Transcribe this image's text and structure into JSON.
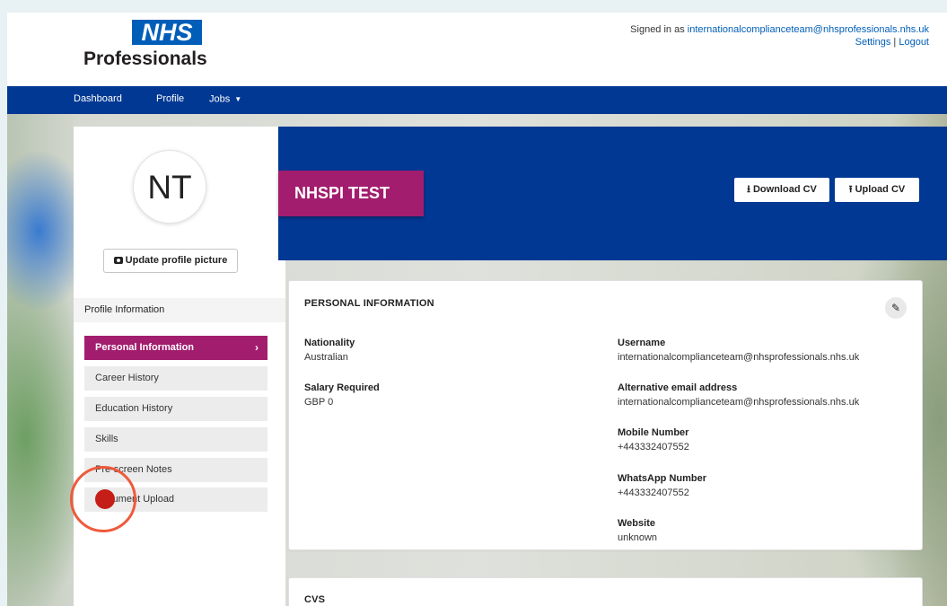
{
  "header": {
    "logo_mark": "NHS",
    "logo_word": "Professionals",
    "signed_in_prefix": "Signed in as",
    "signed_in_email": "internationalcomplianceteam@nhsprofessionals.nhs.uk",
    "settings_link": "Settings",
    "separator": "|",
    "logout_link": "Logout"
  },
  "nav": {
    "items": [
      "Dashboard",
      "Profile",
      "Jobs"
    ]
  },
  "sidebar": {
    "avatar_initials": "NT",
    "update_picture_label": "Update profile picture",
    "section_heading": "Profile Information",
    "items": [
      {
        "label": "Personal Information",
        "active": true
      },
      {
        "label": "Career History",
        "active": false
      },
      {
        "label": "Education History",
        "active": false
      },
      {
        "label": "Skills",
        "active": false
      },
      {
        "label": "Pre-screen Notes",
        "active": false
      },
      {
        "label": "Document Upload",
        "active": false
      }
    ]
  },
  "banner": {
    "name": "NHSPI TEST",
    "download_cv_label": "Download CV",
    "upload_cv_label": "Upload CV"
  },
  "personal_info": {
    "title": "PERSONAL INFORMATION",
    "left_fields": [
      {
        "label": "Nationality",
        "value": "Australian"
      },
      {
        "label": "Salary Required",
        "value": "GBP 0"
      }
    ],
    "right_fields": [
      {
        "label": "Username",
        "value": "internationalcomplianceteam@nhsprofessionals.nhs.uk"
      },
      {
        "label": "Alternative email address",
        "value": "internationalcomplianceteam@nhsprofessionals.nhs.uk"
      },
      {
        "label": "Mobile Number",
        "value": "+443332407552"
      },
      {
        "label": "WhatsApp Number",
        "value": "+443332407552"
      },
      {
        "label": "Website",
        "value": "unknown"
      }
    ]
  },
  "cvs": {
    "title": "CVS"
  },
  "colors": {
    "nav_blue": "#003893",
    "nhs_blue": "#005eb8",
    "accent_magenta": "#a21d6e",
    "click_indicator": "#ee5a3c"
  }
}
